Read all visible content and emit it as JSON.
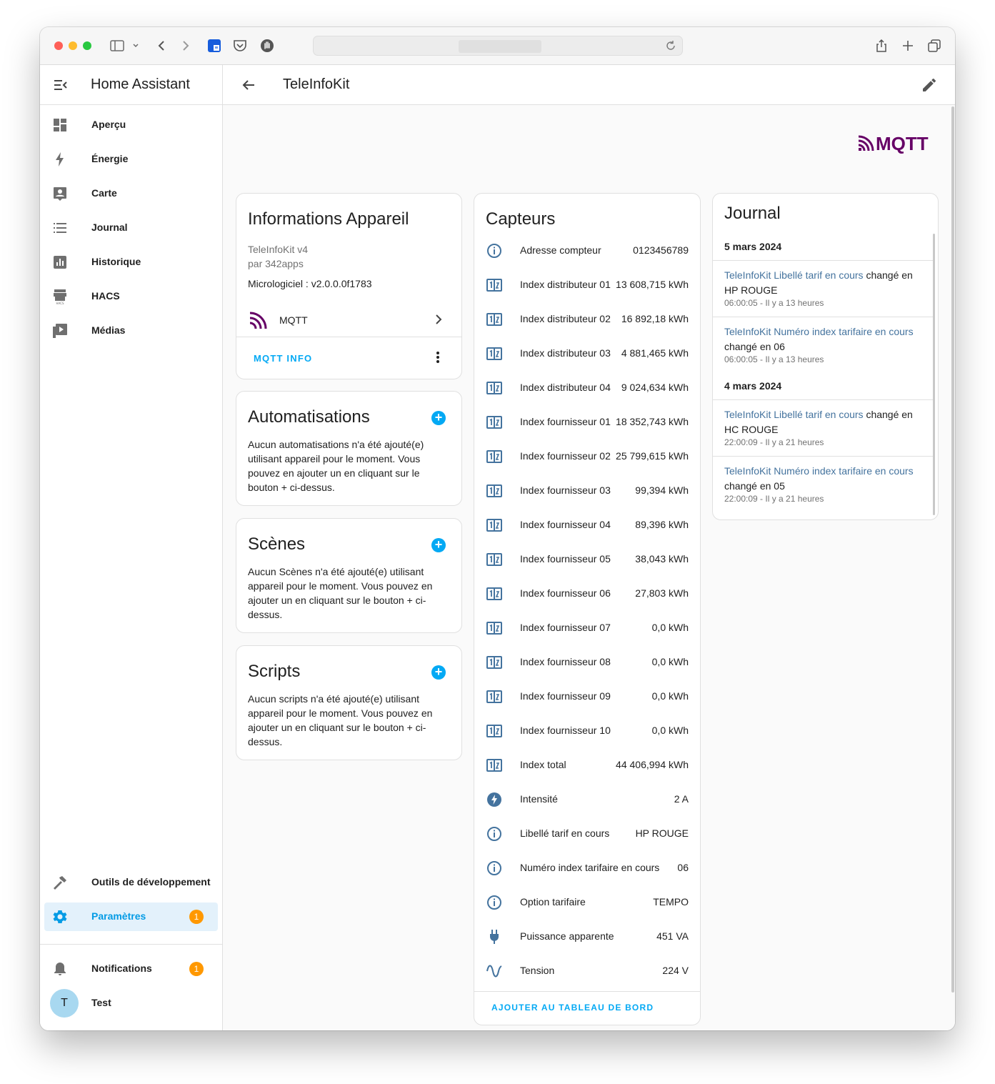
{
  "browser": {
    "url_blurred": ""
  },
  "sidebar": {
    "title": "Home Assistant",
    "items": [
      {
        "label": "Aperçu",
        "icon": "dashboard-icon"
      },
      {
        "label": "Énergie",
        "icon": "lightning-icon"
      },
      {
        "label": "Carte",
        "icon": "map-account-icon"
      },
      {
        "label": "Journal",
        "icon": "list-icon"
      },
      {
        "label": "Historique",
        "icon": "chart-box-icon"
      },
      {
        "label": "HACS",
        "icon": "hacs-store-icon"
      },
      {
        "label": "Médias",
        "icon": "play-box-icon"
      }
    ],
    "dev_tools": {
      "label": "Outils de développement",
      "icon": "hammer-icon"
    },
    "settings": {
      "label": "Paramètres",
      "icon": "gear-icon",
      "badge": "1"
    },
    "notifications": {
      "label": "Notifications",
      "icon": "bell-icon",
      "badge": "1"
    },
    "user": {
      "initial": "T",
      "name": "Test"
    }
  },
  "header": {
    "title": "TeleInfoKit"
  },
  "integration_logo": "MQTT",
  "device_info": {
    "title": "Informations Appareil",
    "model": "TeleInfoKit v4",
    "manufacturer": "par 342apps",
    "firmware": "Micrologiciel : v2.0.0.0f1783",
    "integration": "MQTT",
    "action": "MQTT INFO"
  },
  "automations": {
    "title": "Automatisations",
    "text": "Aucun automatisations n'a été ajouté(e) utilisant appareil pour le moment. Vous pouvez en ajouter un en cliquant sur le bouton + ci-dessus."
  },
  "scenes": {
    "title": "Scènes",
    "text": "Aucun Scènes n'a été ajouté(e) utilisant appareil pour le moment. Vous pouvez en ajouter un en cliquant sur le bouton + ci-dessus."
  },
  "scripts": {
    "title": "Scripts",
    "text": "Aucun scripts n'a été ajouté(e) utilisant appareil pour le moment. Vous pouvez en ajouter un en cliquant sur le bouton + ci-dessus."
  },
  "sensors": {
    "title": "Capteurs",
    "action": "AJOUTER AU TABLEAU DE BORD",
    "rows": [
      {
        "name": "Adresse compteur",
        "value": "0123456789",
        "icon": "information-icon"
      },
      {
        "name": "Index distributeur 01",
        "value": "13 608,715 kWh",
        "icon": "counter-icon"
      },
      {
        "name": "Index distributeur 02",
        "value": "16 892,18 kWh",
        "icon": "counter-icon"
      },
      {
        "name": "Index distributeur 03",
        "value": "4 881,465 kWh",
        "icon": "counter-icon"
      },
      {
        "name": "Index distributeur 04",
        "value": "9 024,634 kWh",
        "icon": "counter-icon"
      },
      {
        "name": "Index fournisseur 01",
        "value": "18 352,743 kWh",
        "icon": "counter-icon"
      },
      {
        "name": "Index fournisseur 02",
        "value": "25 799,615 kWh",
        "icon": "counter-icon"
      },
      {
        "name": "Index fournisseur 03",
        "value": "99,394 kWh",
        "icon": "counter-icon"
      },
      {
        "name": "Index fournisseur 04",
        "value": "89,396 kWh",
        "icon": "counter-icon"
      },
      {
        "name": "Index fournisseur 05",
        "value": "38,043 kWh",
        "icon": "counter-icon"
      },
      {
        "name": "Index fournisseur 06",
        "value": "27,803 kWh",
        "icon": "counter-icon"
      },
      {
        "name": "Index fournisseur 07",
        "value": "0,0 kWh",
        "icon": "counter-icon"
      },
      {
        "name": "Index fournisseur 08",
        "value": "0,0 kWh",
        "icon": "counter-icon"
      },
      {
        "name": "Index fournisseur 09",
        "value": "0,0 kWh",
        "icon": "counter-icon"
      },
      {
        "name": "Index fournisseur 10",
        "value": "0,0 kWh",
        "icon": "counter-icon"
      },
      {
        "name": "Index total",
        "value": "44 406,994 kWh",
        "icon": "counter-icon"
      },
      {
        "name": "Intensité",
        "value": "2 A",
        "icon": "flash-circle-icon"
      },
      {
        "name": "Libellé tarif en cours",
        "value": "HP ROUGE",
        "icon": "information-icon"
      },
      {
        "name": "Numéro index tarifaire en cours",
        "value": "06",
        "icon": "information-icon"
      },
      {
        "name": "Option tarifaire",
        "value": "TEMPO",
        "icon": "information-icon"
      },
      {
        "name": "Puissance apparente",
        "value": "451 VA",
        "icon": "power-plug-icon"
      },
      {
        "name": "Tension",
        "value": "224 V",
        "icon": "sine-wave-icon"
      }
    ]
  },
  "logbook": {
    "title": "Journal",
    "groups": [
      {
        "date": "5 mars 2024",
        "entries": [
          {
            "entity": "TeleInfoKit Libellé tarif en cours",
            "action": "changé en",
            "value": "HP ROUGE",
            "when": "06:00:05 - Il y a 13 heures"
          },
          {
            "entity": "TeleInfoKit Numéro index tarifaire en cours",
            "action": "changé en",
            "value": "06",
            "when": "06:00:05 - Il y a 13 heures"
          }
        ]
      },
      {
        "date": "4 mars 2024",
        "entries": [
          {
            "entity": "TeleInfoKit Libellé tarif en cours",
            "action": "changé en",
            "value": "HC ROUGE",
            "when": "22:00:09 - Il y a 21 heures"
          },
          {
            "entity": "TeleInfoKit Numéro index tarifaire en cours",
            "action": "changé en",
            "value": "05",
            "when": "22:00:09 - Il y a 21 heures"
          }
        ]
      }
    ]
  },
  "colors": {
    "accent": "#03a9f4",
    "entity_link": "#44739e",
    "badge": "#ff9800",
    "mqtt_brand": "#660066",
    "active_bg": "#e3f1fb"
  }
}
